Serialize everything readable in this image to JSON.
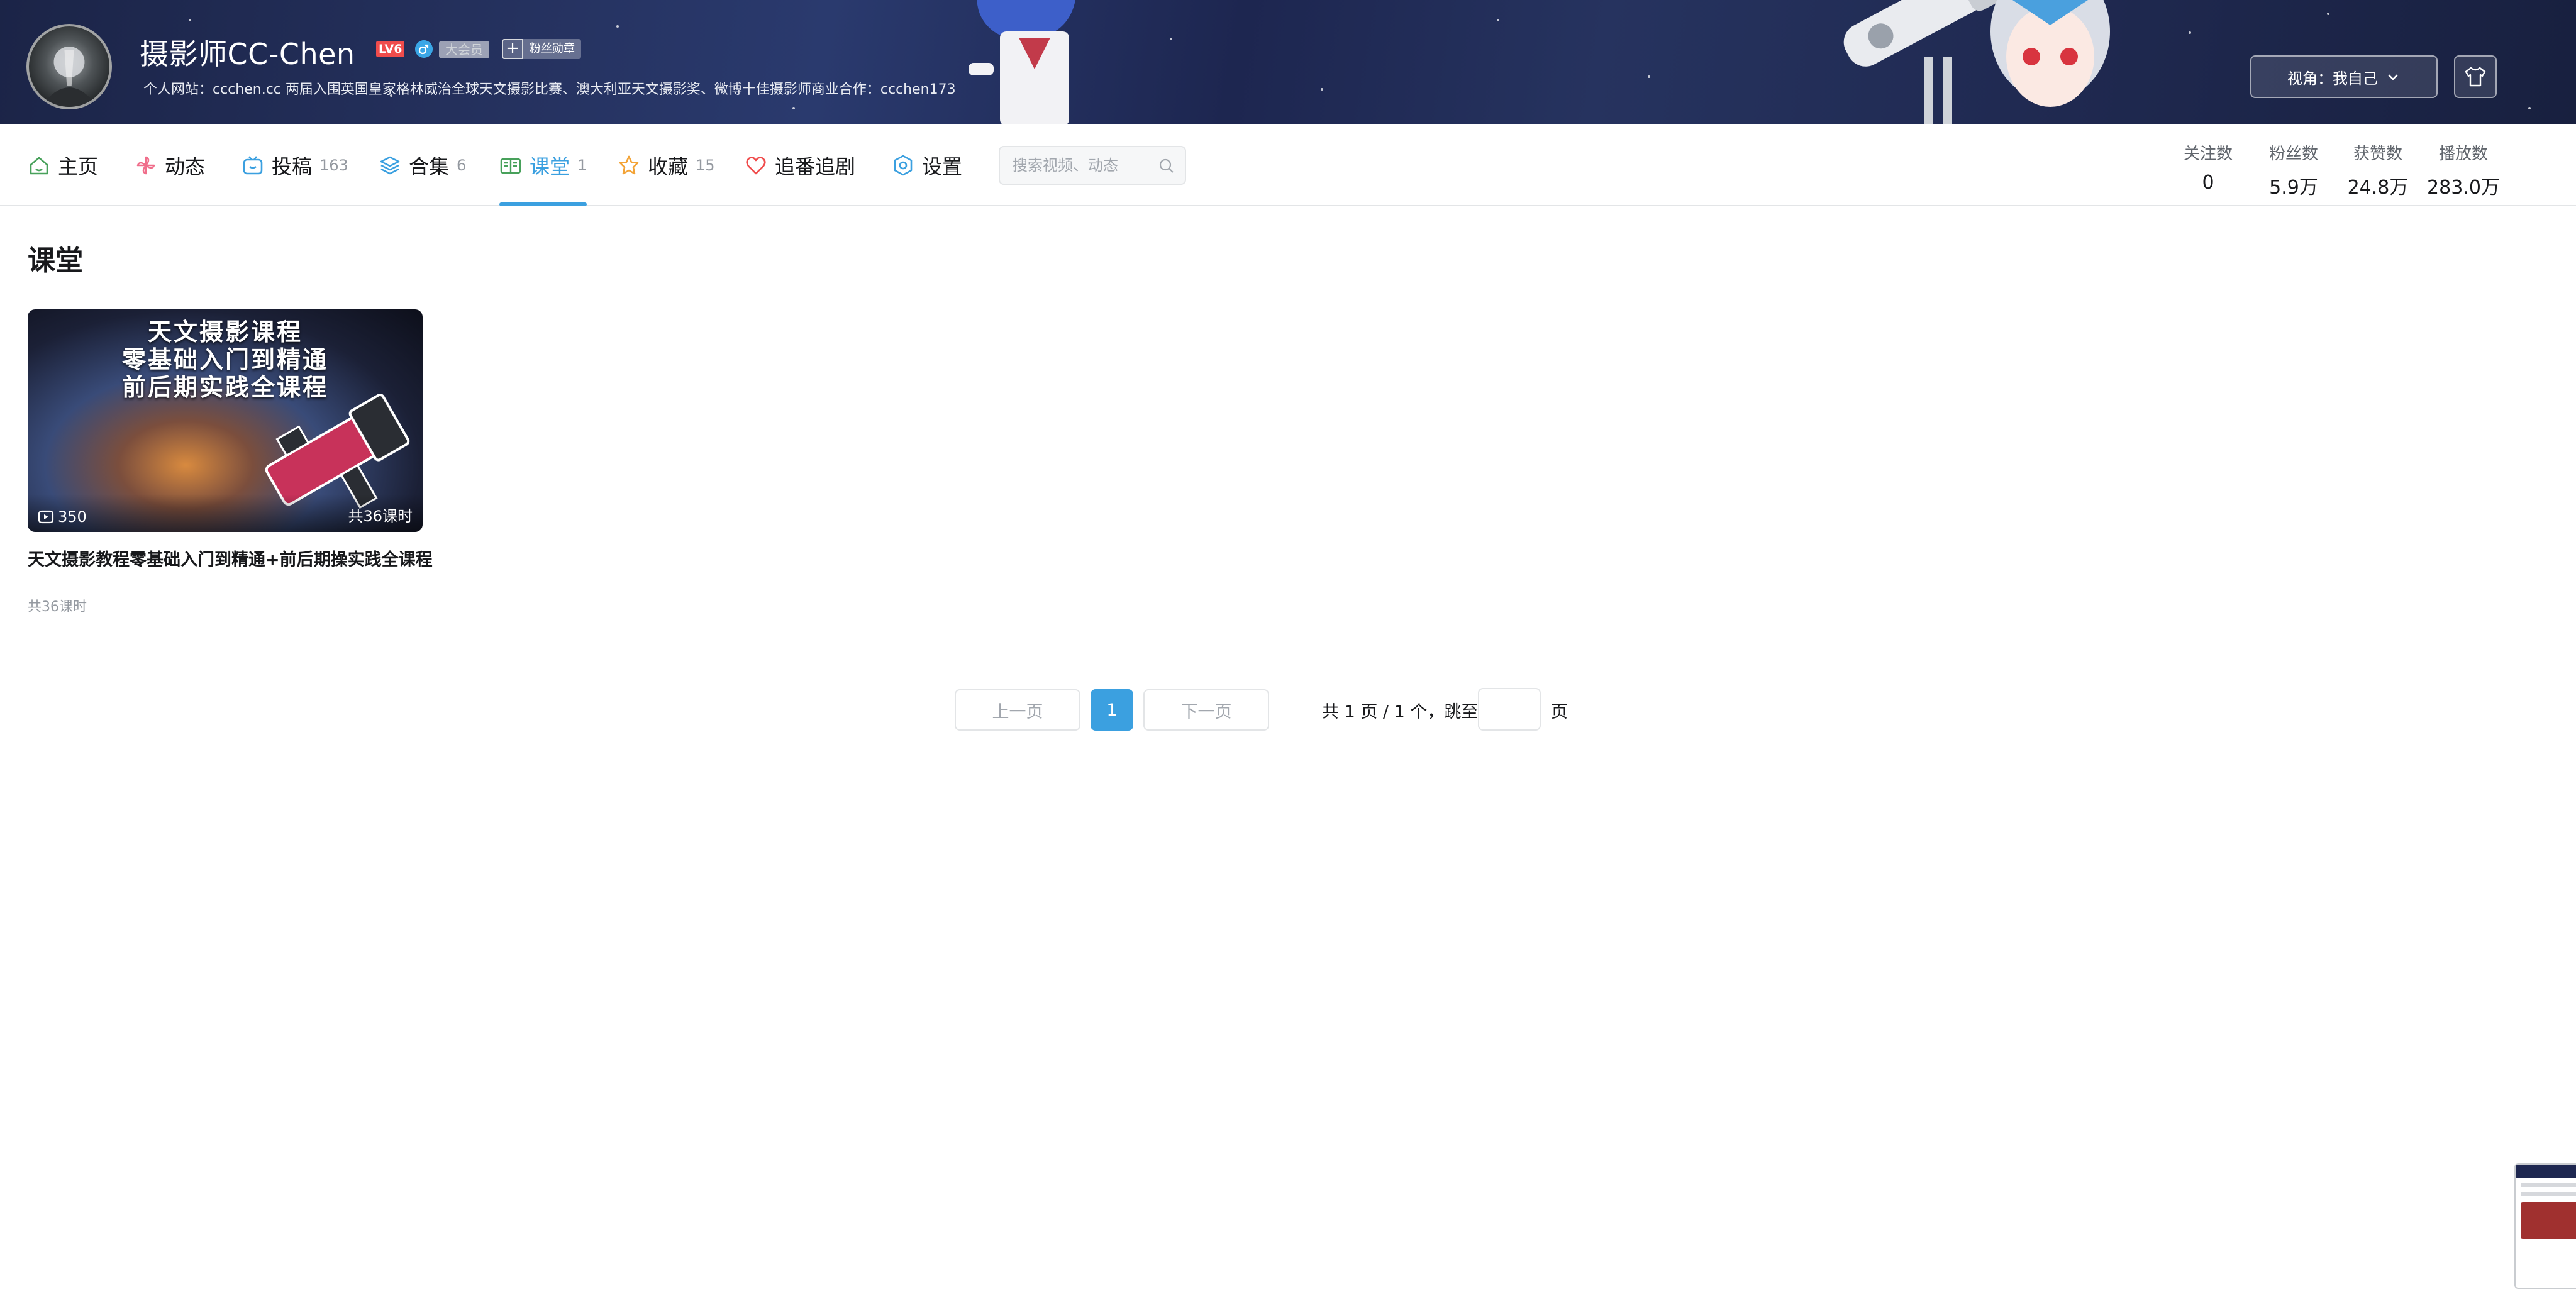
{
  "profile": {
    "username": "摄影师CC-Chen",
    "level": "LV6",
    "vip_label": "大会员",
    "fan_badge_label": "粉丝勋章",
    "sign": "个人网站：ccchen.cc 两届入围英国皇家格林威治全球天文摄影比赛、澳大利亚天文摄影奖、微博十佳摄影师商业合作：ccchen173"
  },
  "banner_controls": {
    "view_label": "视角：我自己",
    "skin_icon": "shirt-icon"
  },
  "nav": {
    "items": [
      {
        "label": "主页",
        "count": "",
        "icon": "home-icon",
        "color": "#48a15b"
      },
      {
        "label": "动态",
        "count": "",
        "icon": "pinwheel-icon",
        "color": "#f06e8b"
      },
      {
        "label": "投稿",
        "count": "163",
        "icon": "tv-icon",
        "color": "#3ba0e0"
      },
      {
        "label": "合集",
        "count": "6",
        "icon": "layers-icon",
        "color": "#3ba0e0"
      },
      {
        "label": "课堂",
        "count": "1",
        "icon": "book-icon",
        "color": "#48a15b"
      },
      {
        "label": "收藏",
        "count": "15",
        "icon": "star-icon",
        "color": "#f3a336"
      },
      {
        "label": "追番追剧",
        "count": "",
        "icon": "heart-icon",
        "color": "#f04c4c"
      },
      {
        "label": "设置",
        "count": "",
        "icon": "gear-icon",
        "color": "#3ba0e0"
      }
    ],
    "active_index": 4,
    "search_placeholder": "搜索视频、动态"
  },
  "stats": [
    {
      "label": "关注数",
      "value": "0"
    },
    {
      "label": "粉丝数",
      "value": "5.9万"
    },
    {
      "label": "获赞数",
      "value": "24.8万"
    },
    {
      "label": "播放数",
      "value": "283.0万"
    }
  ],
  "section": {
    "title": "课堂"
  },
  "course": {
    "cover_lines": [
      "天文摄影课程",
      "零基础入门到精通",
      "前后期实践全课程"
    ],
    "play_count": "350",
    "lesson_count": "共36课时",
    "title": "天文摄影教程零基础入门到精通+前后期操实践全课程",
    "meta": "共36课时"
  },
  "pagination": {
    "prev": "上一页",
    "current": "1",
    "next": "下一页",
    "info": "共 1 页 / 1 个，跳至",
    "suffix": "页",
    "jump_value": ""
  },
  "colors": {
    "accent": "#3ba0e0",
    "banner": "#1f2a55"
  }
}
